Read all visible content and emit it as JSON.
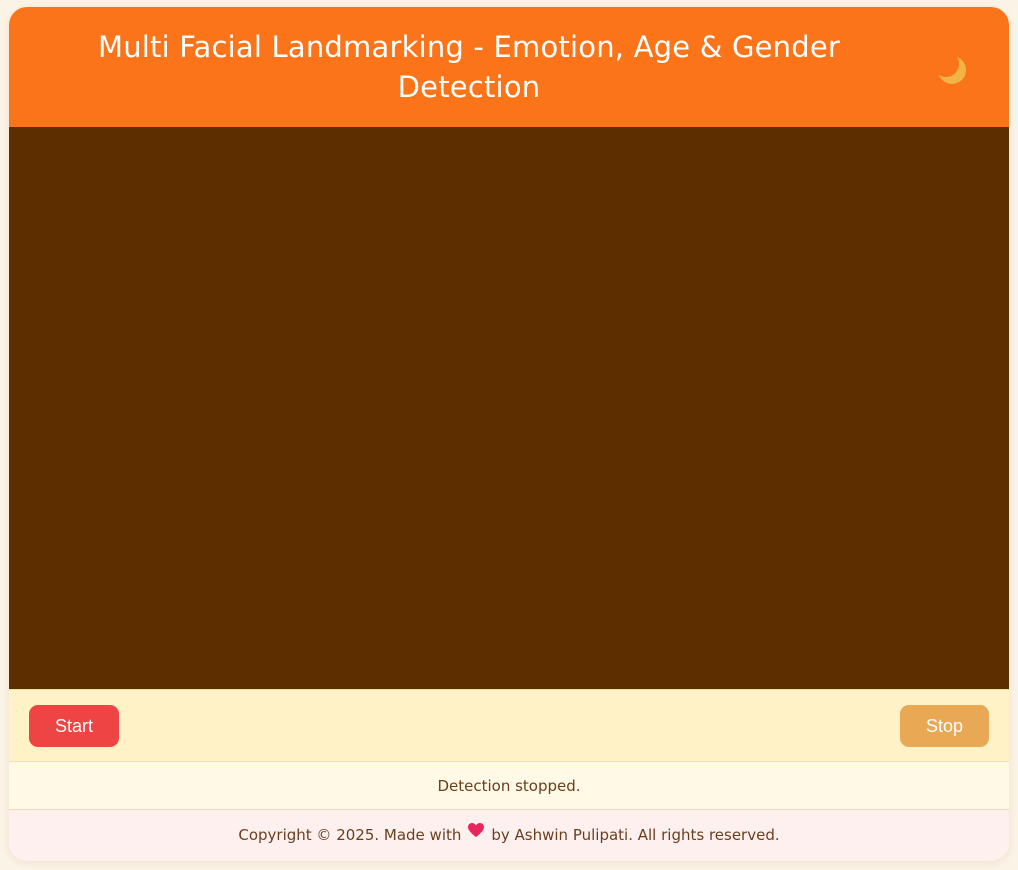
{
  "header": {
    "title": "Multi Facial Landmarking - Emotion, Age & Gender Detection",
    "theme_toggle_icon": "crescent-moon-icon"
  },
  "controls": {
    "start_label": "Start",
    "stop_label": "Stop"
  },
  "status": {
    "text": "Detection stopped."
  },
  "footer": {
    "text_before": "Copyright © 2025. Made with",
    "heart_icon": "heart-icon",
    "text_after": "by Ashwin Pulipati. All rights reserved."
  },
  "colors": {
    "header_bg": "#fb7419",
    "video_bg": "#5c2e00",
    "start_button": "#ef4444",
    "stop_button": "#e9a954",
    "controls_bg": "#fef2c6",
    "status_bg": "#fff9e6",
    "footer_bg": "#fff0f0"
  }
}
